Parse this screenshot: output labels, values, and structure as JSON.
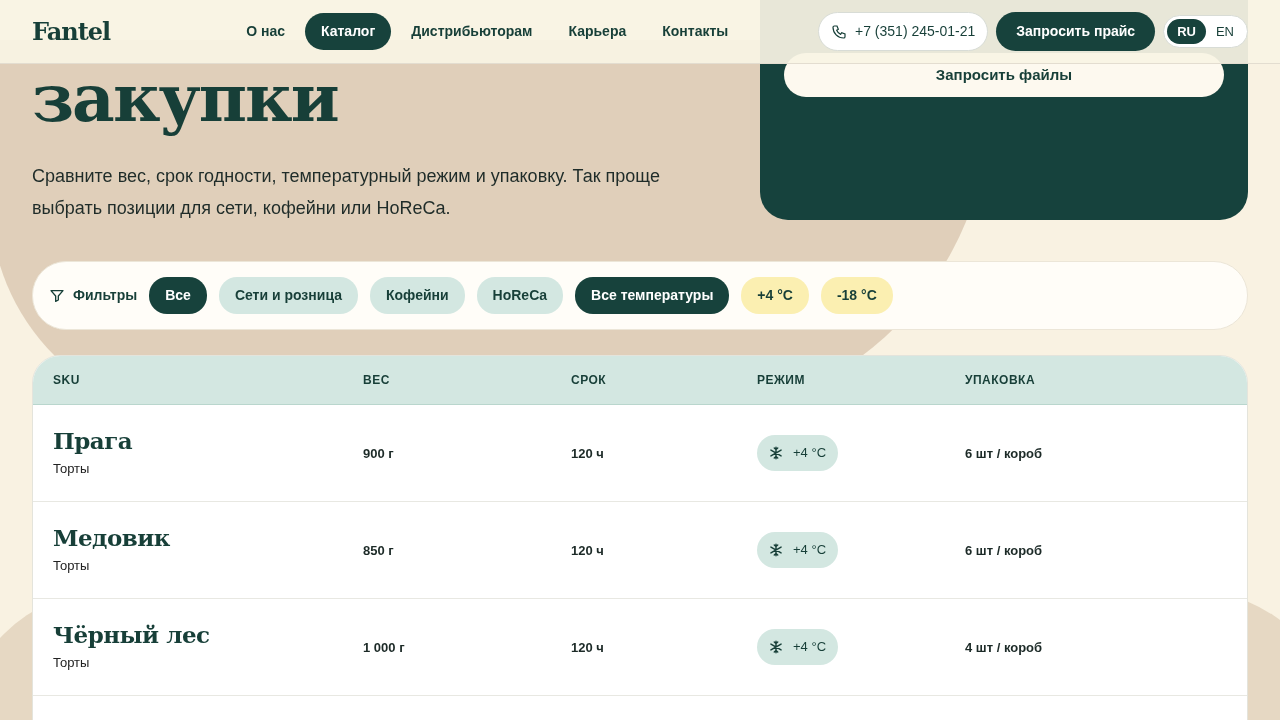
{
  "header": {
    "logo": "Fantel",
    "nav": [
      {
        "label": "О нас",
        "selected": false
      },
      {
        "label": "Каталог",
        "selected": true
      },
      {
        "label": "Дистрибьюторам",
        "selected": false
      },
      {
        "label": "Карьера",
        "selected": false
      },
      {
        "label": "Контакты",
        "selected": false
      }
    ],
    "phone": "+7 (351) 245-01-21",
    "cta": "Запросить прайс",
    "languages": [
      {
        "label": "RU",
        "selected": true
      },
      {
        "label": "EN",
        "selected": false
      }
    ]
  },
  "hero": {
    "title": "закупки",
    "text": "Сравните вес, срок годности, температурный режим и упаковку. Так проще выбрать позиции для сети, кофейни или HoReCa."
  },
  "files_card": {
    "button": "Запросить файлы"
  },
  "filters": {
    "label": "Фильтры",
    "chips": [
      {
        "label": "Все",
        "kind": "audience",
        "selected": true
      },
      {
        "label": "Сети и розница",
        "kind": "audience",
        "selected": false
      },
      {
        "label": "Кофейни",
        "kind": "audience",
        "selected": false
      },
      {
        "label": "HoReCa",
        "kind": "audience",
        "selected": false
      },
      {
        "label": "Все температуры",
        "kind": "temperature",
        "selected": true
      },
      {
        "label": "+4 °C",
        "kind": "temperature",
        "selected": false
      },
      {
        "label": "-18 °C",
        "kind": "temperature",
        "selected": false
      }
    ]
  },
  "table": {
    "columns": [
      "SKU",
      "ВЕС",
      "СРОК",
      "РЕЖИМ",
      "УПАКОВКА"
    ],
    "rows": [
      {
        "name": "Прага",
        "category": "Торты",
        "weight": "900 г",
        "shelf_life": "120 ч",
        "mode": "+4 °C",
        "packaging": "6 шт / короб"
      },
      {
        "name": "Медовик",
        "category": "Торты",
        "weight": "850 г",
        "shelf_life": "120 ч",
        "mode": "+4 °C",
        "packaging": "6 шт / короб"
      },
      {
        "name": "Чёрный лес",
        "category": "Торты",
        "weight": "1 000 г",
        "shelf_life": "120 ч",
        "mode": "+4 °C",
        "packaging": "4 шт / короб"
      }
    ]
  }
}
